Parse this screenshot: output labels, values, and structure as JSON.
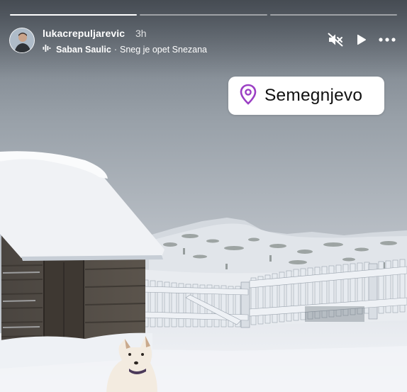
{
  "story": {
    "username": "lukacrepuljarevic",
    "time_ago": "3h",
    "music": {
      "artist": "Saban Saulic",
      "separator": "·",
      "song": "Sneg je opet Snezana"
    },
    "progress_segments": [
      1,
      0,
      0
    ]
  },
  "location_sticker": {
    "label": "Semegnjevo",
    "pin_color": "#9b3fc4"
  },
  "icons": {
    "mute": "speaker-muted-icon",
    "play": "play-icon",
    "more": "more-dots-icon",
    "music": "music-bars-icon",
    "location": "location-pin-icon"
  }
}
